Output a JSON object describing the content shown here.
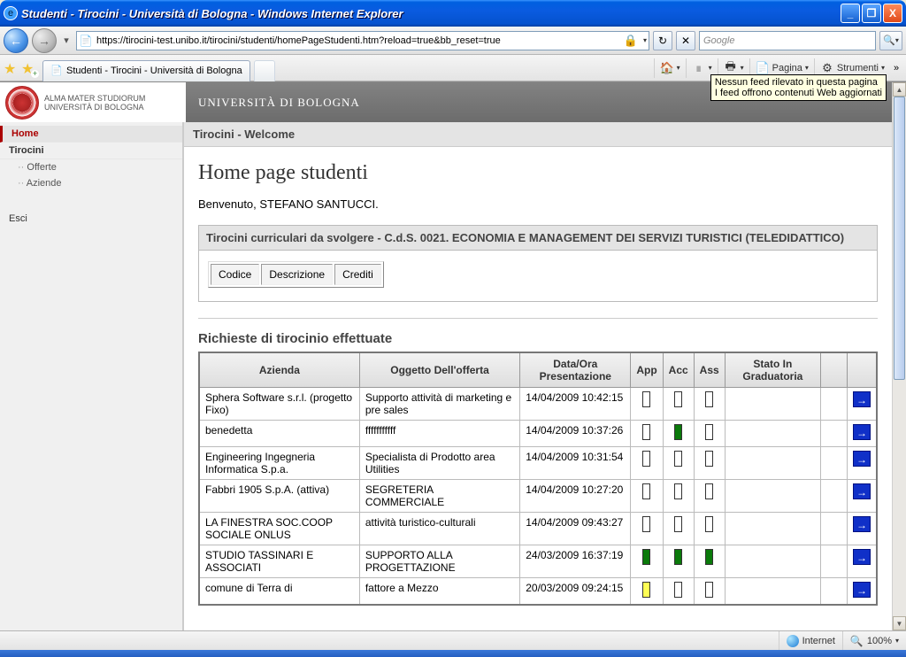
{
  "window": {
    "title": "Studenti - Tirocini - Università di Bologna - Windows Internet Explorer"
  },
  "address": {
    "url": "https://tirocini-test.unibo.it/tirocini/studenti/homePageStudenti.htm?reload=true&bb_reset=true",
    "search_placeholder": "Google"
  },
  "tab": {
    "label": "Studenti - Tirocini - Università di Bologna"
  },
  "commandbar": {
    "pagina": "Pagina",
    "strumenti": "Strumenti"
  },
  "tooltip": {
    "line1": "Nessun feed rilevato in questa pagina",
    "line2": "I feed offrono contenuti Web aggiornati"
  },
  "uni": {
    "logo_line1": "ALMA MATER STUDIORUM",
    "logo_line2": "UNIVERSITÀ DI BOLOGNA",
    "band_label": "UNIVERSITÀ DI BOLOGNA"
  },
  "nav": {
    "home": "Home",
    "tirocini": "Tirocini",
    "offerte": "Offerte",
    "aziende": "Aziende",
    "esci": "Esci"
  },
  "page": {
    "breadcrumb": "Tirocini - Welcome",
    "h1": "Home page studenti",
    "welcome": "Benvenuto, STEFANO SANTUCCI.",
    "panel_title": "Tirocini curriculari da svolgere - C.d.S. 0021. ECONOMIA E MANAGEMENT DEI SERVIZI TURISTICI (TELEDIDATTICO)",
    "mini_headers": {
      "codice": "Codice",
      "descrizione": "Descrizione",
      "crediti": "Crediti"
    },
    "requests_title": "Richieste di tirocinio effettuate",
    "cols": {
      "azienda": "Azienda",
      "oggetto": "Oggetto Dell'offerta",
      "data": "Data/Ora Presentazione",
      "app": "App",
      "acc": "Acc",
      "ass": "Ass",
      "stato": "Stato In Graduatoria"
    },
    "rows": [
      {
        "azienda": "Sphera Software s.r.l. (progetto Fixo)",
        "oggetto": "Supporto attività di marketing e pre sales",
        "data": "14/04/2009 10:42:15",
        "app": "empty",
        "acc": "empty",
        "ass": "empty"
      },
      {
        "azienda": "benedetta",
        "oggetto": "fffffffffff",
        "data": "14/04/2009 10:37:26",
        "app": "empty",
        "acc": "green",
        "ass": "empty"
      },
      {
        "azienda": "Engineering Ingegneria Informatica S.p.a.",
        "oggetto": "Specialista di Prodotto area Utilities",
        "data": "14/04/2009 10:31:54",
        "app": "empty",
        "acc": "empty",
        "ass": "empty"
      },
      {
        "azienda": "Fabbri 1905 S.p.A. (attiva)",
        "oggetto": "SEGRETERIA COMMERCIALE",
        "data": "14/04/2009 10:27:20",
        "app": "empty",
        "acc": "empty",
        "ass": "empty"
      },
      {
        "azienda": "LA FINESTRA SOC.COOP SOCIALE ONLUS",
        "oggetto": "attività turistico-culturali",
        "data": "14/04/2009 09:43:27",
        "app": "empty",
        "acc": "empty",
        "ass": "empty"
      },
      {
        "azienda": "STUDIO TASSINARI E ASSOCIATI",
        "oggetto": "SUPPORTO ALLA PROGETTAZIONE",
        "data": "24/03/2009 16:37:19",
        "app": "green",
        "acc": "green",
        "ass": "green"
      },
      {
        "azienda": "comune di Terra di",
        "oggetto": "fattore a Mezzo",
        "data": "20/03/2009 09:24:15",
        "app": "yellow",
        "acc": "empty",
        "ass": "empty"
      }
    ]
  },
  "status": {
    "zone": "Internet",
    "zoom": "100%"
  }
}
